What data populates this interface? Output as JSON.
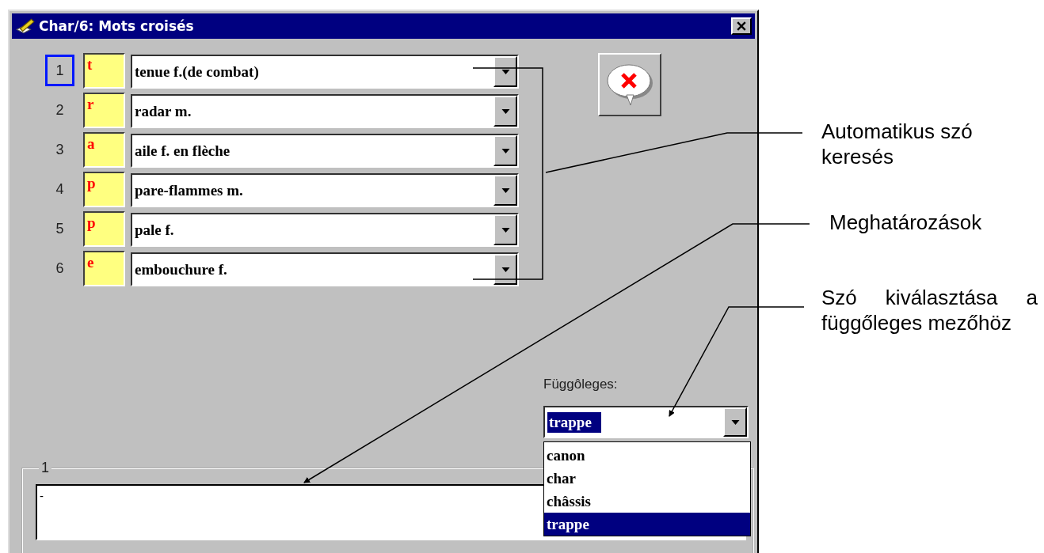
{
  "window": {
    "title": "Char/6: Mots croisés"
  },
  "words": [
    {
      "number": "1",
      "letter": "t",
      "value": "tenue f.(de combat)",
      "selected": true
    },
    {
      "number": "2",
      "letter": "r",
      "value": "radar m.",
      "selected": false
    },
    {
      "number": "3",
      "letter": "a",
      "value": "aile f. en flèche",
      "selected": false
    },
    {
      "number": "4",
      "letter": "p",
      "value": "pare-flammes m.",
      "selected": false
    },
    {
      "number": "5",
      "letter": "p",
      "value": "pale f.",
      "selected": false
    },
    {
      "number": "6",
      "letter": "e",
      "value": "embouchure f.",
      "selected": false
    }
  ],
  "vertical": {
    "label": "Függôleges:",
    "value": "trappe",
    "options": [
      {
        "label": "canon",
        "selected": false
      },
      {
        "label": "char",
        "selected": false
      },
      {
        "label": "châssis",
        "selected": false
      },
      {
        "label": "trappe",
        "selected": true
      }
    ]
  },
  "definition": {
    "title": "1",
    "text": "-"
  },
  "annotations": [
    {
      "text": "Automatikus szó keresés"
    },
    {
      "text": "Meghatározások"
    },
    {
      "text": "Szó kiválasztása a függőleges mezőhöz"
    }
  ]
}
